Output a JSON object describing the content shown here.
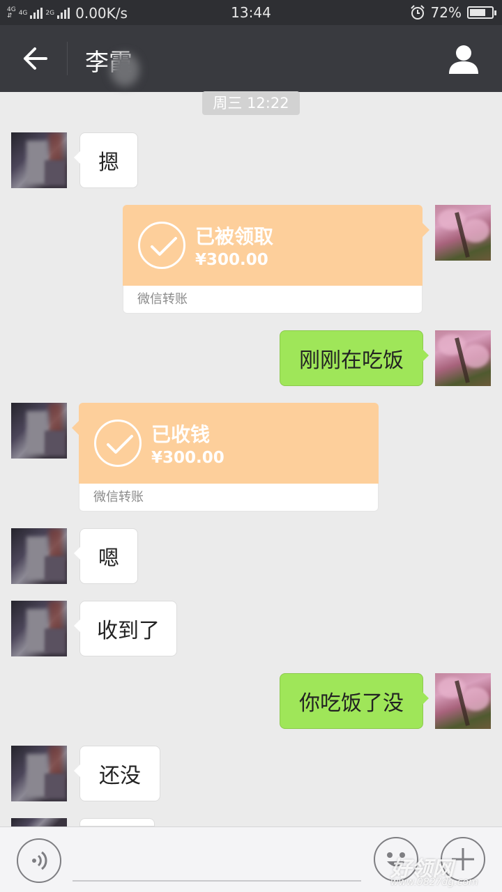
{
  "status_bar": {
    "network_top": "4G",
    "network_2": "4G",
    "network_3": "2G",
    "speed": "0.00K/s",
    "time": "13:44",
    "battery": "72%",
    "battery_level": 0.72
  },
  "header": {
    "title": "李霞"
  },
  "timestamp": "周三 12:22",
  "messages": [
    {
      "side": "them",
      "type": "text",
      "text": "摁"
    },
    {
      "side": "me",
      "type": "transfer",
      "title": "已被领取",
      "amount": "¥300.00",
      "footer": "微信转账"
    },
    {
      "side": "me",
      "type": "text",
      "text": "刚刚在吃饭"
    },
    {
      "side": "them",
      "type": "transfer",
      "title": "已收钱",
      "amount": "¥300.00",
      "footer": "微信转账"
    },
    {
      "side": "them",
      "type": "text",
      "text": "嗯"
    },
    {
      "side": "them",
      "type": "text",
      "text": "收到了"
    },
    {
      "side": "me",
      "type": "text",
      "text": "你吃饭了没"
    },
    {
      "side": "them",
      "type": "text",
      "text": "还没"
    }
  ],
  "watermark": {
    "text": "好领网",
    "url": "www.0827dg.com"
  },
  "icons": {
    "back": "arrow-left-icon",
    "profile": "person-icon",
    "voice": "voice-icon",
    "emoji": "smiley-icon",
    "more": "plus-icon"
  },
  "colors": {
    "title_bar": "#393a3f",
    "chat_bg": "#ebebeb",
    "my_bubble": "#9fe659",
    "transfer": "#fdcf9b"
  }
}
